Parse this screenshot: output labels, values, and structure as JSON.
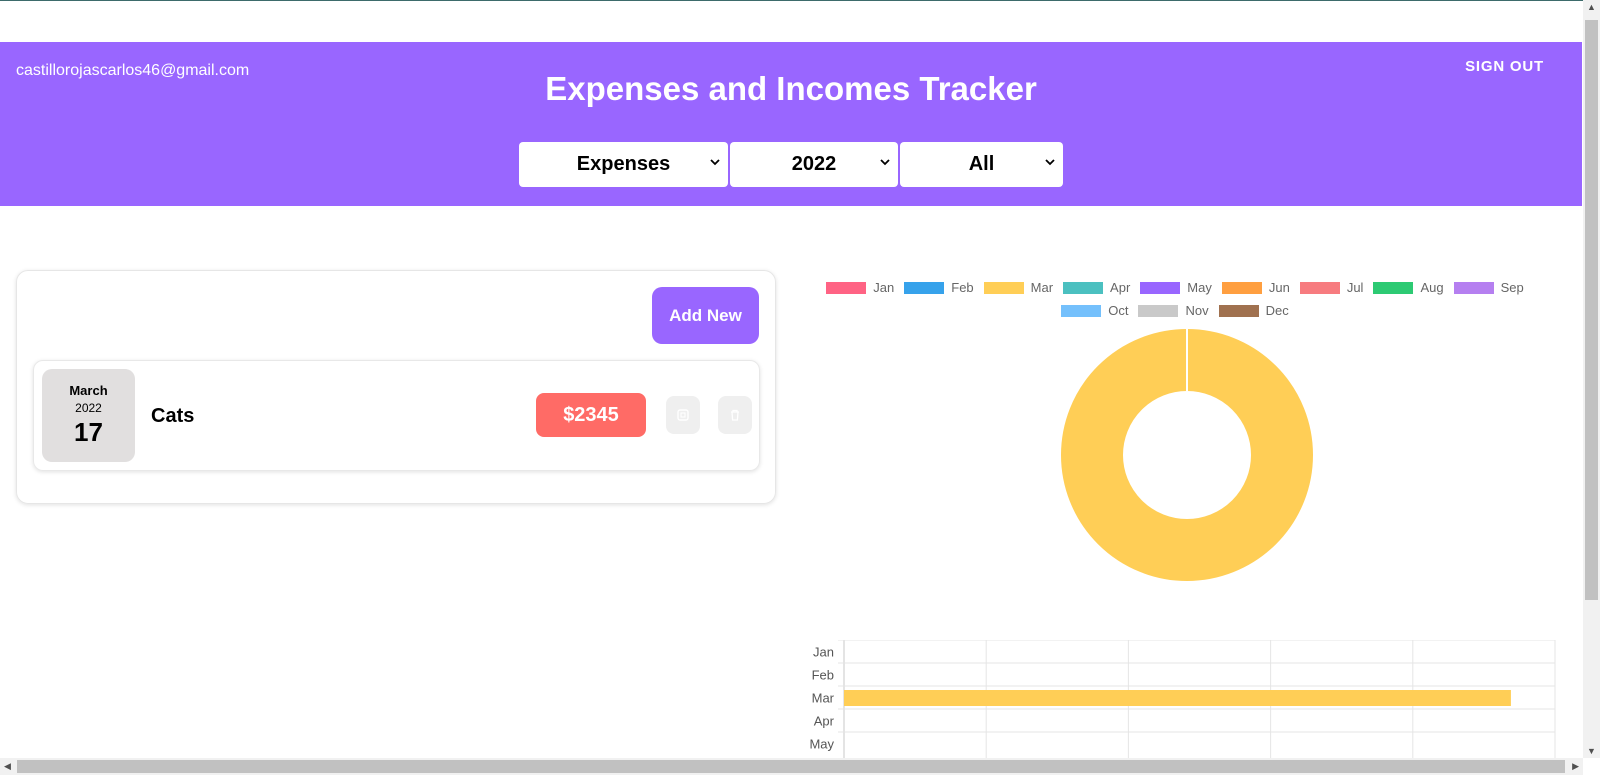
{
  "header": {
    "user_email": "castillorojascarlos46@gmail.com",
    "title": "Expenses and Incomes Tracker",
    "sign_out_label": "SIGN OUT",
    "filters": {
      "type": "Expenses",
      "year": "2022",
      "month": "All"
    }
  },
  "main": {
    "add_new_label": "Add New",
    "entries": [
      {
        "month": "March",
        "year": "2022",
        "day": "17",
        "title": "Cats",
        "amount": "$2345"
      }
    ]
  },
  "colors": {
    "brand": "#9966ff",
    "amount_badge": "#ff6b66"
  },
  "chart_data": [
    {
      "type": "pie",
      "variant": "doughnut",
      "legend_position": "top",
      "categories": [
        "Jan",
        "Feb",
        "Mar",
        "Apr",
        "May",
        "Jun",
        "Jul",
        "Aug",
        "Sep",
        "Oct",
        "Nov",
        "Dec"
      ],
      "colors": [
        "#ff6384",
        "#36a2eb",
        "#ffce56",
        "#4bc0c0",
        "#9966ff",
        "#ff9f40",
        "#f77b7f",
        "#2dca73",
        "#b57ff0",
        "#74c0fc",
        "#c9c9c9",
        "#a0714f"
      ],
      "values": [
        0,
        0,
        2345,
        0,
        0,
        0,
        0,
        0,
        0,
        0,
        0,
        0
      ]
    },
    {
      "type": "bar",
      "orientation": "horizontal",
      "categories": [
        "Jan",
        "Feb",
        "Mar",
        "Apr",
        "May"
      ],
      "values": [
        0,
        0,
        2345,
        0,
        0
      ],
      "xlim": [
        0,
        2500
      ],
      "grid": true,
      "bar_color": "#ffce56"
    }
  ]
}
